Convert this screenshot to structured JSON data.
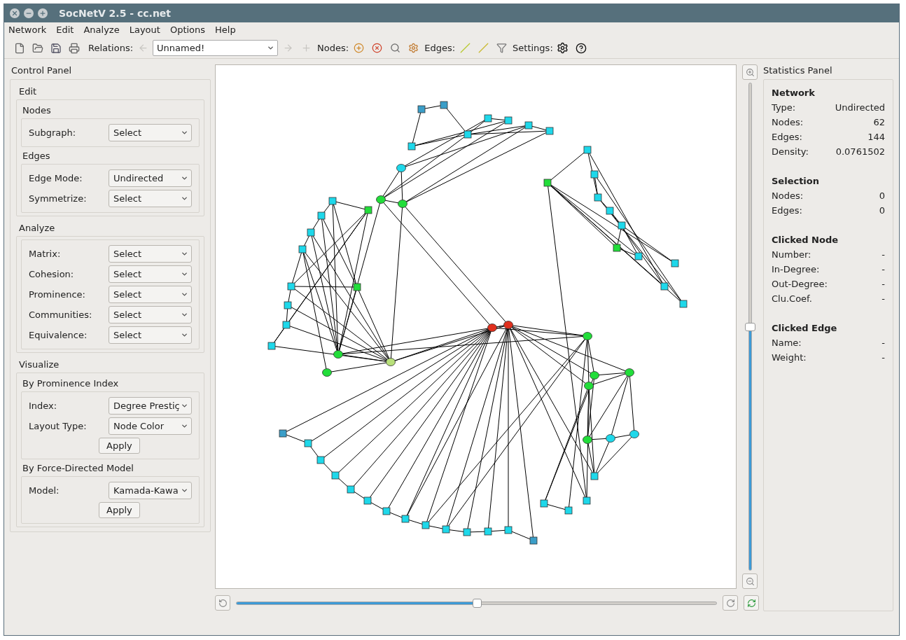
{
  "window": {
    "title": "SocNetV 2.5 - cc.net"
  },
  "menu": [
    "Network",
    "Edit",
    "Analyze",
    "Layout",
    "Options",
    "Help"
  ],
  "toolbar": {
    "relations_label": "Relations:",
    "relation_combo": "Unnamed!",
    "nodes_label": "Nodes:",
    "edges_label": "Edges:",
    "settings_label": "Settings:"
  },
  "control_panel": {
    "title": "Control Panel",
    "sections": [
      {
        "title": "Edit",
        "groups": [
          {
            "title": "Nodes",
            "fields": [
              {
                "label": "Subgraph:",
                "value": "Select"
              }
            ]
          },
          {
            "title": "Edges",
            "fields": [
              {
                "label": "Edge Mode:",
                "value": "Undirected"
              },
              {
                "label": "Symmetrize:",
                "value": "Select"
              }
            ]
          }
        ]
      },
      {
        "title": "Analyze",
        "groups": [
          {
            "fields": [
              {
                "label": "Matrix:",
                "value": "Select"
              },
              {
                "label": "Cohesion:",
                "value": "Select"
              },
              {
                "label": "Prominence:",
                "value": "Select"
              },
              {
                "label": "Communities:",
                "value": "Select"
              },
              {
                "label": "Equivalence:",
                "value": "Select"
              }
            ]
          }
        ]
      },
      {
        "title": "Visualize",
        "groups": [
          {
            "title": "By Prominence Index",
            "fields": [
              {
                "label": "Index:",
                "value": "Degree Prestiç"
              },
              {
                "label": "Layout Type:",
                "value": "Node Color"
              }
            ],
            "button": "Apply"
          },
          {
            "title": "By Force-Directed Model",
            "fields": [
              {
                "label": "Model:",
                "value": "Kamada-Kawa"
              }
            ],
            "button": "Apply"
          }
        ]
      }
    ]
  },
  "zoom_slider": {
    "level": 0.5
  },
  "rotate_slider": {
    "level": 0.5
  },
  "statistics_panel": {
    "title": "Statistics Panel",
    "sections": [
      {
        "title": "Network",
        "rows": [
          {
            "label": "Type:",
            "value": "Undirected"
          },
          {
            "label": "Nodes:",
            "value": "62"
          },
          {
            "label": "Edges:",
            "value": "144"
          },
          {
            "label": "Density:",
            "value": "0.0761502"
          }
        ]
      },
      {
        "title": "Selection",
        "rows": [
          {
            "label": "Nodes:",
            "value": "0"
          },
          {
            "label": "Edges:",
            "value": "0"
          }
        ]
      },
      {
        "title": "Clicked Node",
        "rows": [
          {
            "label": "Number:",
            "value": "-"
          },
          {
            "label": "In-Degree:",
            "value": "-"
          },
          {
            "label": "Out-Degree:",
            "value": "-"
          },
          {
            "label": "Clu.Coef.",
            "value": "-"
          }
        ]
      },
      {
        "title": "Clicked Edge",
        "rows": [
          {
            "label": "Name:",
            "value": "-"
          },
          {
            "label": "Weight:",
            "value": "-"
          }
        ]
      }
    ]
  }
}
